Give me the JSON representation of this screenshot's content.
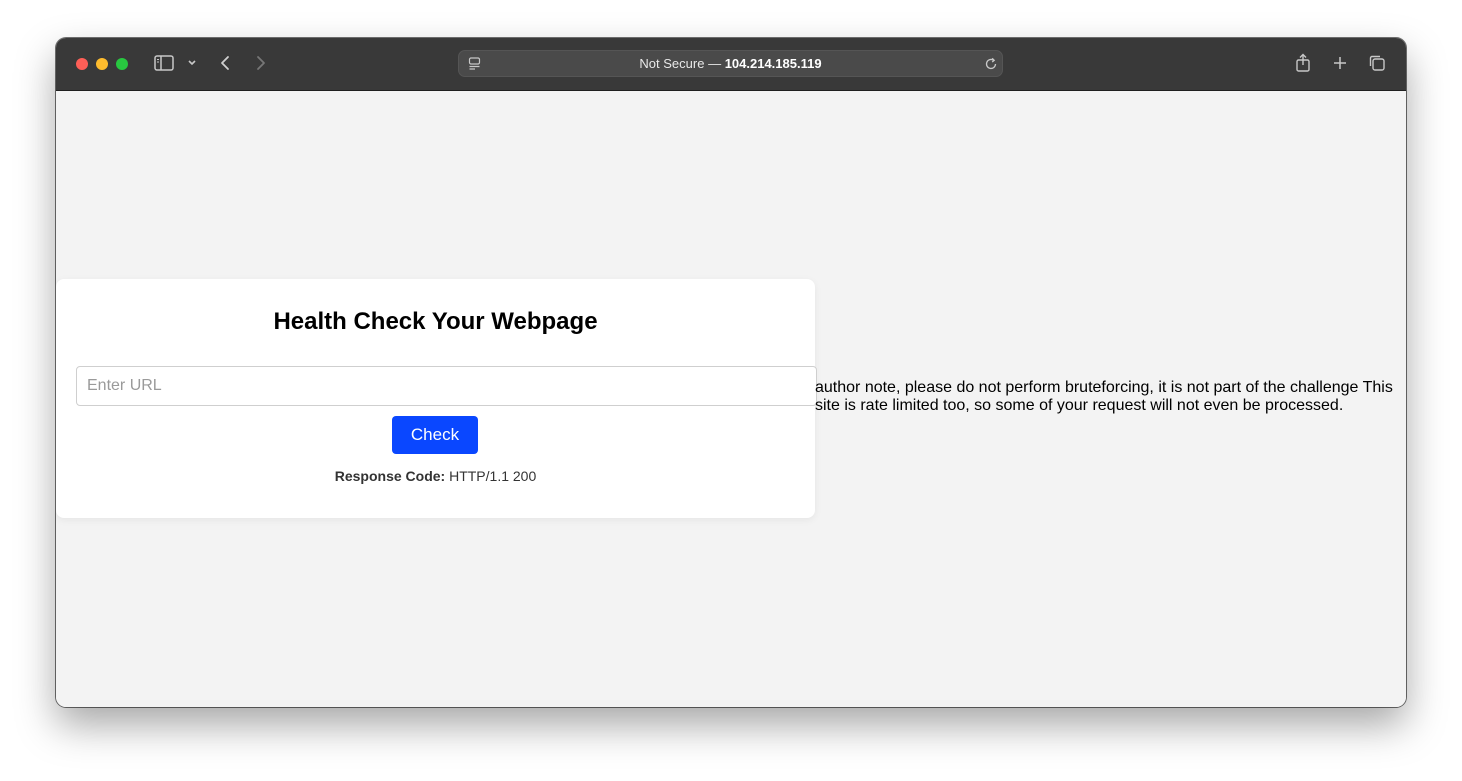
{
  "browser": {
    "address_prefix": "Not Secure — ",
    "address_host": "104.214.185.119"
  },
  "page": {
    "title": "Health Check Your Webpage",
    "url_placeholder": "Enter URL",
    "url_value": "",
    "check_label": "Check",
    "response_label": "Response Code:",
    "response_value": "HTTP/1.1 200",
    "author_note": "author note, please do not perform bruteforcing, it is not part of the challenge This site is rate limited too, so some of your request will not even be processed."
  },
  "colors": {
    "button": "#0a47ff",
    "toolbar": "#393939",
    "page_bg": "#f3f3f3"
  },
  "icons": [
    "sidebar-icon",
    "chevron-down-icon",
    "back-icon",
    "forward-icon",
    "site-info-icon",
    "reload-icon",
    "share-icon",
    "new-tab-icon",
    "tabs-overview-icon"
  ]
}
